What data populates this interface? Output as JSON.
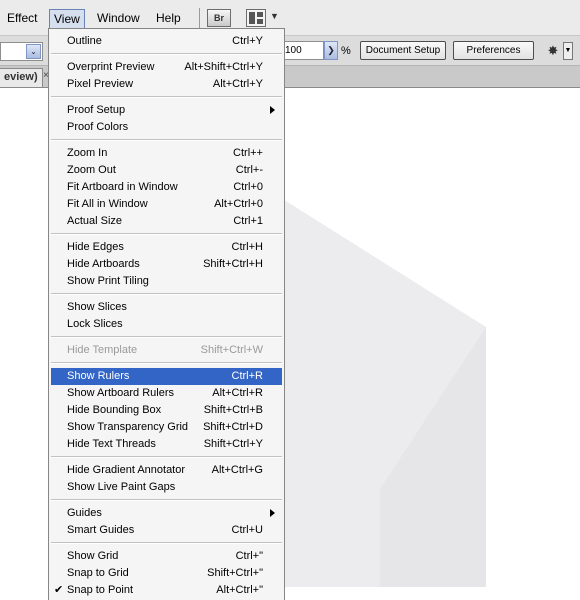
{
  "menubar": {
    "items": [
      "Effect",
      "View",
      "Window",
      "Help"
    ],
    "bridge_label": "Br",
    "arrange_icon": "arrange-documents-icon"
  },
  "control_bar": {
    "opacity_value": "100",
    "opacity_unit": "%",
    "document_setup_label": "Document Setup",
    "preferences_label": "Preferences",
    "tool_icon": "magic-wand-icon"
  },
  "document_tab": {
    "label": "eview)",
    "close": "×"
  },
  "view_menu": {
    "items": [
      {
        "label": "Outline",
        "shortcut": "Ctrl+Y"
      },
      {
        "separator": true
      },
      {
        "label": "Overprint Preview",
        "shortcut": "Alt+Shift+Ctrl+Y"
      },
      {
        "label": "Pixel Preview",
        "shortcut": "Alt+Ctrl+Y"
      },
      {
        "separator": true
      },
      {
        "label": "Proof Setup",
        "shortcut": "",
        "submenu": true
      },
      {
        "label": "Proof Colors",
        "shortcut": ""
      },
      {
        "separator": true
      },
      {
        "label": "Zoom In",
        "shortcut": "Ctrl++"
      },
      {
        "label": "Zoom Out",
        "shortcut": "Ctrl+-"
      },
      {
        "label": "Fit Artboard in Window",
        "shortcut": "Ctrl+0"
      },
      {
        "label": "Fit All in Window",
        "shortcut": "Alt+Ctrl+0"
      },
      {
        "label": "Actual Size",
        "shortcut": "Ctrl+1"
      },
      {
        "separator": true
      },
      {
        "label": "Hide Edges",
        "shortcut": "Ctrl+H"
      },
      {
        "label": "Hide Artboards",
        "shortcut": "Shift+Ctrl+H"
      },
      {
        "label": "Show Print Tiling",
        "shortcut": ""
      },
      {
        "separator": true
      },
      {
        "label": "Show Slices",
        "shortcut": ""
      },
      {
        "label": "Lock Slices",
        "shortcut": ""
      },
      {
        "separator": true
      },
      {
        "label": "Hide Template",
        "shortcut": "Shift+Ctrl+W",
        "disabled": true
      },
      {
        "separator": true
      },
      {
        "label": "Show Rulers",
        "shortcut": "Ctrl+R",
        "highlighted": true
      },
      {
        "label": "Show Artboard Rulers",
        "shortcut": "Alt+Ctrl+R"
      },
      {
        "label": "Hide Bounding Box",
        "shortcut": "Shift+Ctrl+B"
      },
      {
        "label": "Show Transparency Grid",
        "shortcut": "Shift+Ctrl+D"
      },
      {
        "label": "Hide Text Threads",
        "shortcut": "Shift+Ctrl+Y"
      },
      {
        "separator": true
      },
      {
        "label": "Hide Gradient Annotator",
        "shortcut": "Alt+Ctrl+G"
      },
      {
        "label": "Show Live Paint Gaps",
        "shortcut": ""
      },
      {
        "separator": true
      },
      {
        "label": "Guides",
        "shortcut": "",
        "submenu": true
      },
      {
        "label": "Smart Guides",
        "shortcut": "Ctrl+U"
      },
      {
        "separator": true
      },
      {
        "label": "Show Grid",
        "shortcut": "Ctrl+\""
      },
      {
        "label": "Snap to Grid",
        "shortcut": "Shift+Ctrl+\""
      },
      {
        "label": "Snap to Point",
        "shortcut": "Alt+Ctrl+\"",
        "checked": true
      }
    ]
  },
  "colors": {
    "highlight": "#3265c6",
    "menu_bg": "#f5f5f5",
    "artwork_light": "#ececef",
    "artwork_dark": "#e4e4e6"
  }
}
